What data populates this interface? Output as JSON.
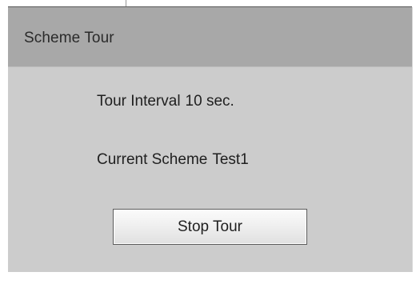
{
  "dialog": {
    "title": "Scheme Tour",
    "tour_interval_label": "Tour Interval",
    "tour_interval_value": "10 sec.",
    "current_scheme_label": "Current Scheme",
    "current_scheme_value": "Test1",
    "stop_button_label": "Stop Tour"
  }
}
